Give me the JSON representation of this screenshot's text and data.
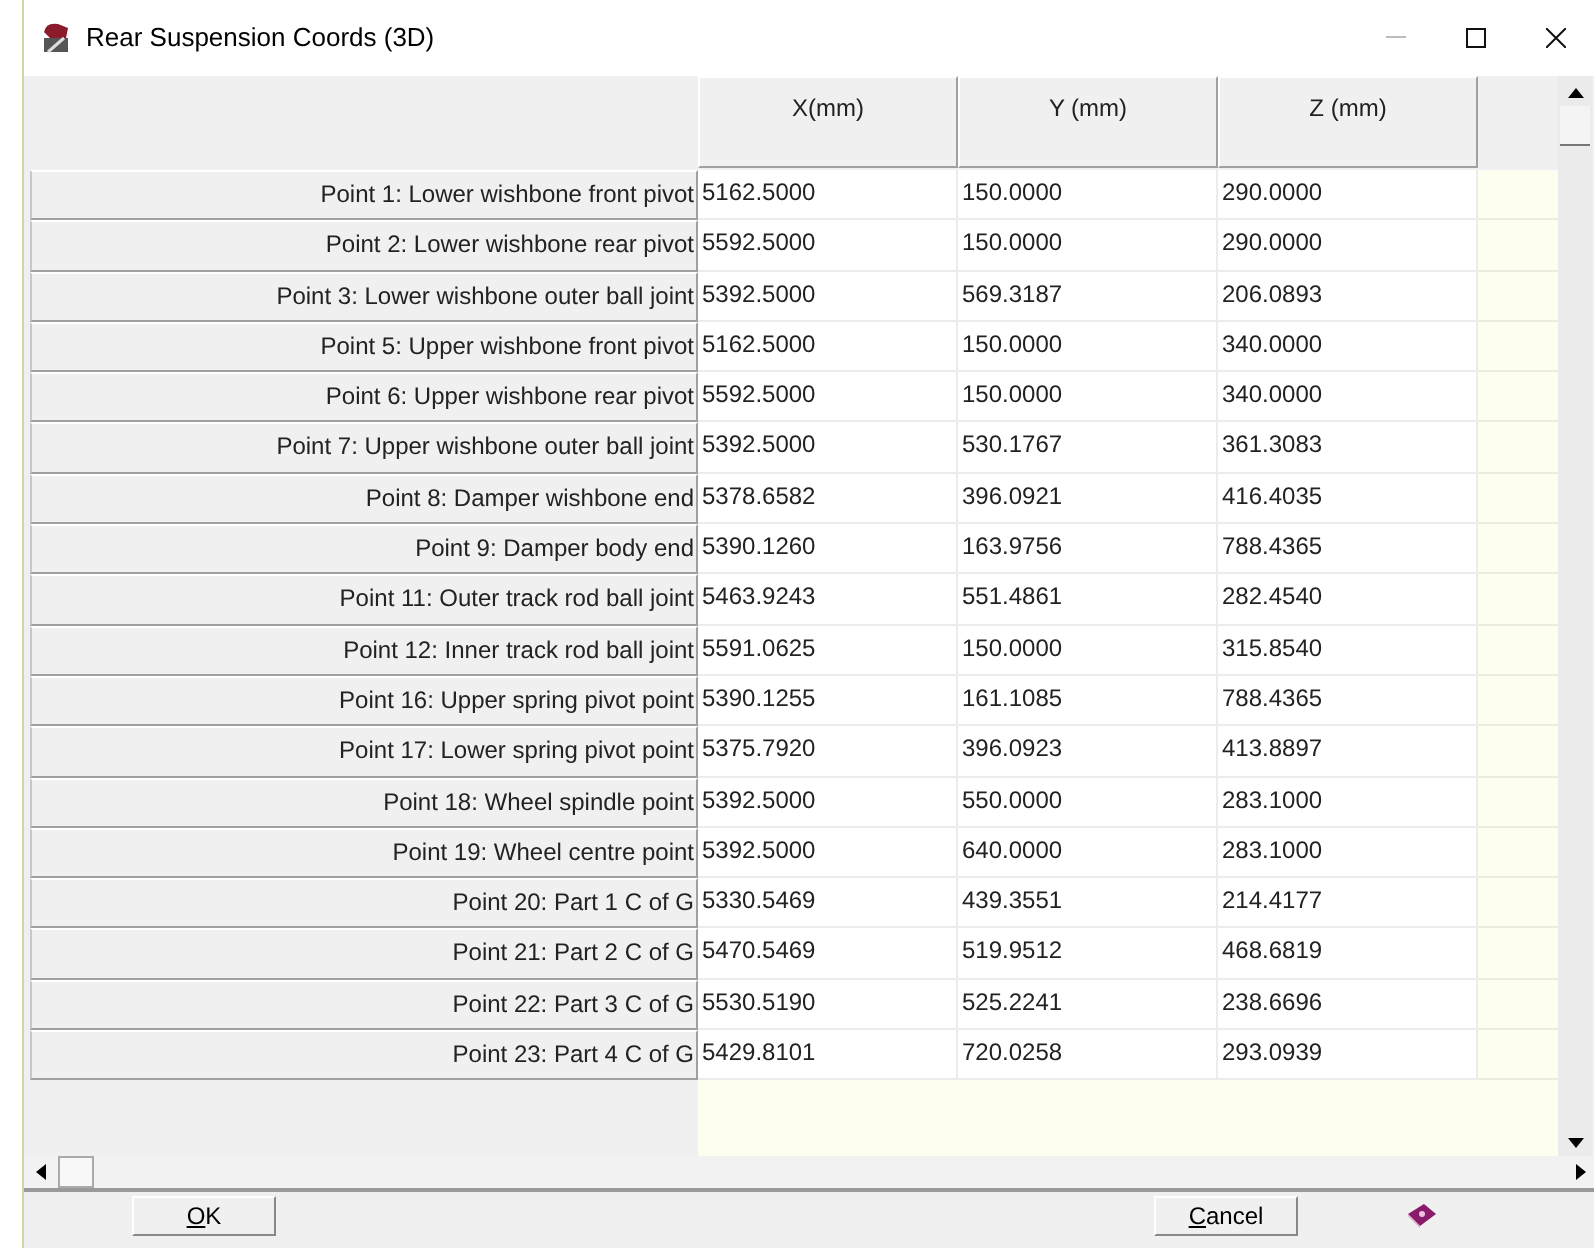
{
  "window": {
    "title": "Rear Suspension Coords (3D)"
  },
  "table": {
    "columns": [
      "X(mm)",
      "Y (mm)",
      "Z (mm)"
    ],
    "rows": [
      {
        "label": "Point 1: Lower wishbone front pivot",
        "values": [
          "5162.5000",
          "150.0000",
          "290.0000"
        ]
      },
      {
        "label": "Point 2: Lower wishbone rear pivot",
        "values": [
          "5592.5000",
          "150.0000",
          "290.0000"
        ]
      },
      {
        "label": "Point 3: Lower wishbone outer ball joint",
        "values": [
          "5392.5000",
          "569.3187",
          "206.0893"
        ]
      },
      {
        "label": "Point 5: Upper wishbone front pivot",
        "values": [
          "5162.5000",
          "150.0000",
          "340.0000"
        ]
      },
      {
        "label": "Point 6: Upper wishbone rear pivot",
        "values": [
          "5592.5000",
          "150.0000",
          "340.0000"
        ]
      },
      {
        "label": "Point 7: Upper wishbone outer ball joint",
        "values": [
          "5392.5000",
          "530.1767",
          "361.3083"
        ]
      },
      {
        "label": "Point 8: Damper wishbone end",
        "values": [
          "5378.6582",
          "396.0921",
          "416.4035"
        ]
      },
      {
        "label": "Point 9: Damper body end",
        "values": [
          "5390.1260",
          "163.9756",
          "788.4365"
        ]
      },
      {
        "label": "Point 11: Outer track rod ball joint",
        "values": [
          "5463.9243",
          "551.4861",
          "282.4540"
        ]
      },
      {
        "label": "Point 12: Inner track rod ball joint",
        "values": [
          "5591.0625",
          "150.0000",
          "315.8540"
        ]
      },
      {
        "label": "Point 16: Upper spring pivot point",
        "values": [
          "5390.1255",
          "161.1085",
          "788.4365"
        ]
      },
      {
        "label": "Point 17: Lower spring pivot point",
        "values": [
          "5375.7920",
          "396.0923",
          "413.8897"
        ]
      },
      {
        "label": "Point 18: Wheel spindle point",
        "values": [
          "5392.5000",
          "550.0000",
          "283.1000"
        ]
      },
      {
        "label": "Point 19: Wheel centre point",
        "values": [
          "5392.5000",
          "640.0000",
          "283.1000"
        ]
      },
      {
        "label": "Point 20: Part 1 C of G",
        "values": [
          "5330.5469",
          "439.3551",
          "214.4177"
        ]
      },
      {
        "label": "Point 21: Part 2 C of G",
        "values": [
          "5470.5469",
          "519.9512",
          "468.6819"
        ]
      },
      {
        "label": "Point 22: Part 3 C of G",
        "values": [
          "5530.5190",
          "525.2241",
          "238.6696"
        ]
      },
      {
        "label": "Point 23: Part 4 C of G",
        "values": [
          "5429.8101",
          "720.0258",
          "293.0939"
        ]
      }
    ]
  },
  "buttons": [
    {
      "label": "OK"
    },
    {
      "label": "Cancel"
    }
  ]
}
